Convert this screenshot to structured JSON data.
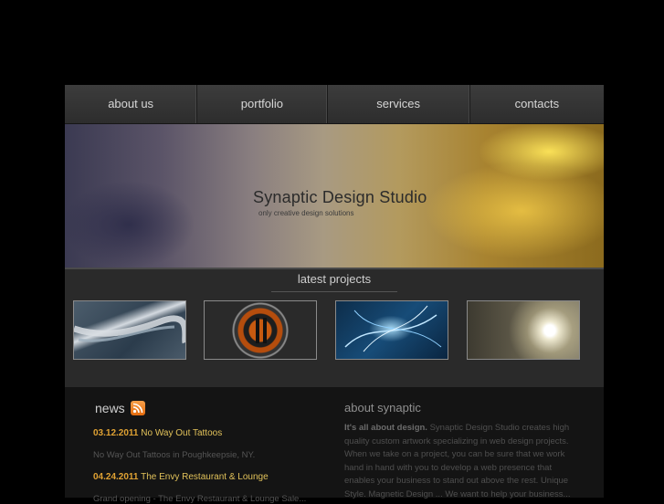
{
  "nav": {
    "items": [
      {
        "label": "about us"
      },
      {
        "label": "portfolio"
      },
      {
        "label": "services"
      },
      {
        "label": "contacts"
      }
    ]
  },
  "banner": {
    "title": "Synaptic Design Studio",
    "tagline": "only creative design solutions"
  },
  "projects": {
    "title": "latest projects",
    "thumbnails": [
      "project-thumbnail-1",
      "project-thumbnail-2",
      "project-thumbnail-3",
      "project-thumbnail-4"
    ]
  },
  "news": {
    "title": "news",
    "icon": "rss-icon",
    "items": [
      {
        "date": "03.12.2011",
        "headline": "No Way Out Tattoos",
        "body": "No Way Out Tattoos in Poughkeepsie, NY."
      },
      {
        "date": "04.24.2011",
        "headline": "The Envy Restaurant & Lounge",
        "body": "Grand opening - The Envy Restaurant & Lounge Sale..."
      }
    ]
  },
  "about": {
    "title": "about synaptic",
    "lead": "It's all about design.",
    "text": " Synaptic Design Studio creates high quality custom artwork specializing in web design projects. When we take on a project, you can be sure that we work hand in hand with you to develop a web presence that enables your business to stand out above the rest. Unique Style. Magnetic Design ... We want to help your business..."
  },
  "colors": {
    "background": "#000000",
    "panel": "#2a2a2a",
    "accent": "#e0a233"
  }
}
